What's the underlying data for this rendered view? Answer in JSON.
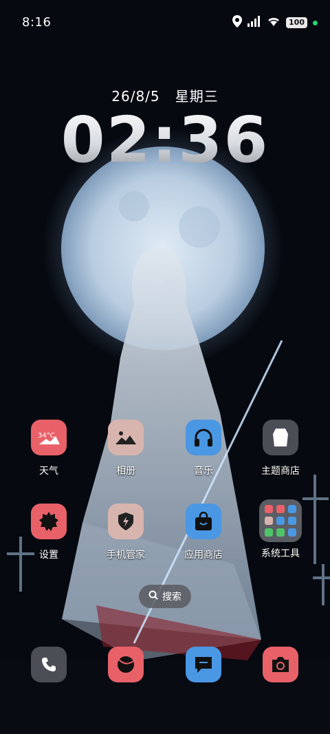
{
  "status_bar": {
    "time": "8:16",
    "battery": "100",
    "icons": [
      "location-icon",
      "signal-icon",
      "wifi-icon",
      "battery-icon"
    ]
  },
  "lockscreen_widget": {
    "date": "26/8/5",
    "weekday": "星期三",
    "clock": "02:36"
  },
  "apps_row1": [
    {
      "label": "天气",
      "icon": "weather-icon",
      "badge": "34°C",
      "color": "#e86168"
    },
    {
      "label": "相册",
      "icon": "gallery-icon",
      "color": "#d8b4ae"
    },
    {
      "label": "音乐",
      "icon": "headphones-icon",
      "color": "#4a97e4"
    },
    {
      "label": "主题商店",
      "icon": "theme-store-icon",
      "color": "#4b4e55"
    }
  ],
  "apps_row2": [
    {
      "label": "设置",
      "icon": "settings-gear-icon",
      "color": "#e86168"
    },
    {
      "label": "手机管家",
      "icon": "phone-manager-icon",
      "color": "#d8b4ae"
    },
    {
      "label": "应用商店",
      "icon": "app-store-icon",
      "color": "#4a97e4"
    },
    {
      "label": "系统工具",
      "icon": "folder-icon",
      "color": "#5b5d62"
    }
  ],
  "search": {
    "label": "搜索"
  },
  "dock": [
    {
      "name": "phone",
      "icon": "phone-icon",
      "color": "#4b4e55"
    },
    {
      "name": "browser",
      "icon": "browser-icon",
      "color": "#e86168"
    },
    {
      "name": "messages",
      "icon": "message-icon",
      "color": "#4a97e4"
    },
    {
      "name": "camera",
      "icon": "camera-icon",
      "color": "#e86168"
    }
  ]
}
